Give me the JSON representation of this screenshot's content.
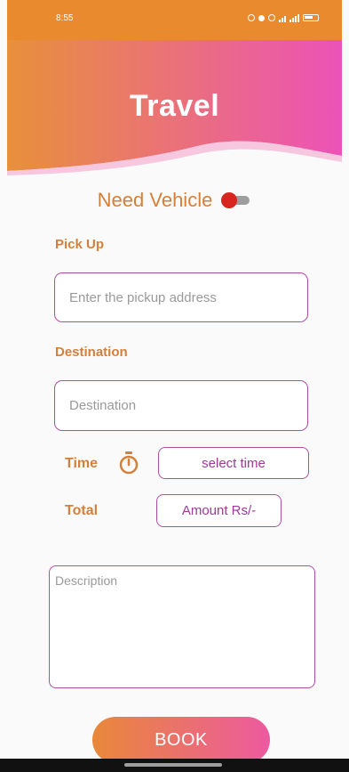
{
  "status_bar": {
    "time": "8:55",
    "indicators": "µ • • œ ‡ ² ™ ©"
  },
  "header": {
    "title": "Travel",
    "gradient_start": "#e8903a",
    "gradient_end": "#ec52b8"
  },
  "need_vehicle": {
    "label": "Need Vehicle",
    "toggle_on": false
  },
  "pickup": {
    "label": "Pick Up",
    "placeholder": "Enter the pickup address"
  },
  "destination": {
    "label": "Destination",
    "placeholder": "Destination"
  },
  "time": {
    "label": "Time",
    "icon": "timer-icon",
    "button_label": "select time"
  },
  "total": {
    "label": "Total",
    "amount_label": "Amount Rs/-"
  },
  "description": {
    "placeholder": "Description"
  },
  "book_button": {
    "label": "BOOK"
  },
  "colors": {
    "accent_label": "#d4803a",
    "field_border": "#b04fa0",
    "toggle_thumb": "#d6261f"
  }
}
